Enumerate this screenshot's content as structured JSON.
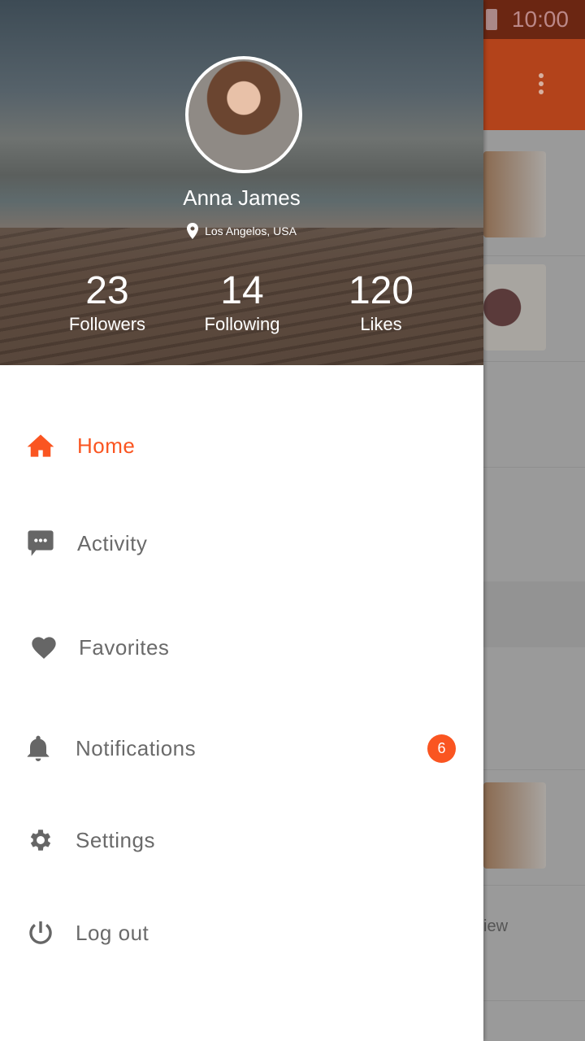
{
  "background_app": {
    "status_time": "10:00",
    "partial_text": "iew",
    "toolbar_color": "#b3431b"
  },
  "profile": {
    "name": "Anna James",
    "location": "Los Angelos, USA",
    "stats": [
      {
        "value": "23",
        "label": "Followers"
      },
      {
        "value": "14",
        "label": "Following"
      },
      {
        "value": "120",
        "label": "Likes"
      }
    ]
  },
  "menu": [
    {
      "label": "Home",
      "icon": "home-icon",
      "active": true
    },
    {
      "label": "Activity",
      "icon": "chat-icon"
    },
    {
      "label": "Favorites",
      "icon": "heart-icon"
    },
    {
      "label": "Notifications",
      "icon": "bell-icon",
      "badge": "6"
    },
    {
      "label": "Settings",
      "icon": "gear-icon"
    },
    {
      "label": "Log out",
      "icon": "power-icon"
    }
  ],
  "colors": {
    "accent": "#fa5521",
    "text": "#6a6a6a",
    "icon": "#666666"
  }
}
